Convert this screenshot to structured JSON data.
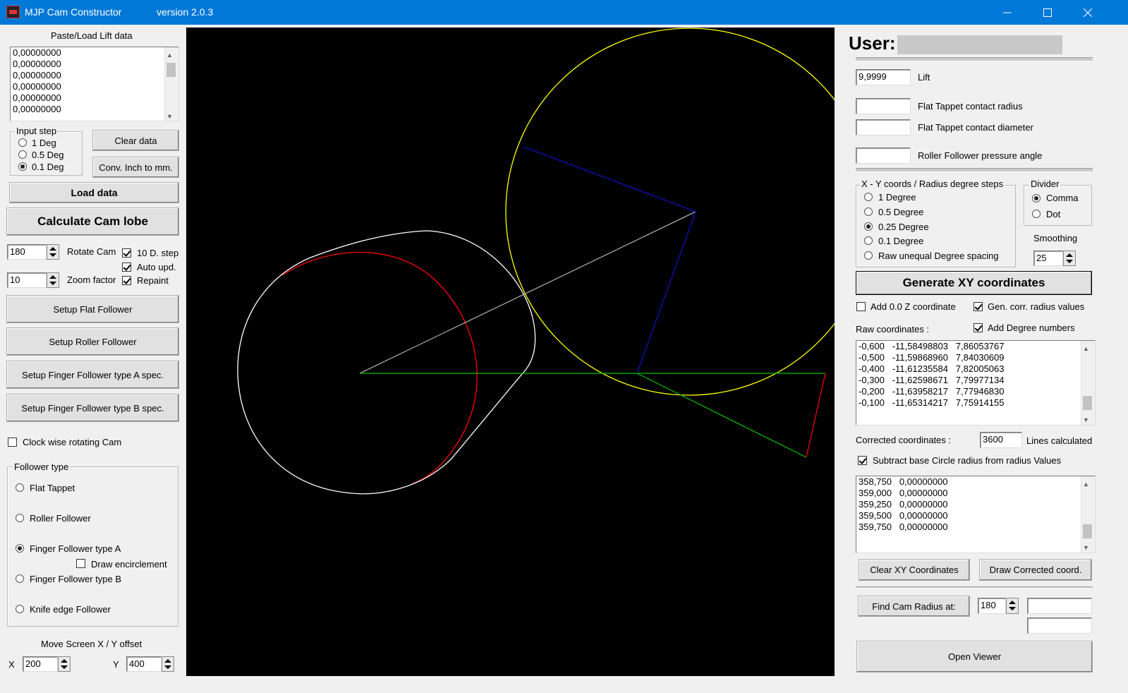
{
  "titlebar": {
    "app_name": "MJP Cam Constructor",
    "version": "version 2.0.3"
  },
  "left": {
    "paste_label": "Paste/Load Lift data",
    "lift_lines": [
      "0,00000000",
      "0,00000000",
      "0,00000000",
      "0,00000000",
      "0,00000000",
      "0,00000000"
    ],
    "input_step": {
      "title": "Input step",
      "options": [
        "1 Deg",
        "0.5 Deg",
        "0.1 Deg"
      ],
      "selected": 2
    },
    "clear_data": "Clear data",
    "conv_inch": "Conv. Inch to mm.",
    "load_data": "Load data",
    "calculate": "Calculate Cam lobe",
    "rotate_value": "180",
    "rotate_label": "Rotate Cam",
    "zoom_value": "10",
    "zoom_label": "Zoom factor",
    "chk_10d": "10 D. step",
    "chk_auto": "Auto upd.",
    "chk_repaint": "Repaint",
    "setup_flat": "Setup Flat Follower",
    "setup_roller": "Setup Roller Follower",
    "setup_finger_a": "Setup Finger Follower type A spec.",
    "setup_finger_b": "Setup Finger Follower type B spec.",
    "clockwise": "Clock wise rotating Cam",
    "follower_type": {
      "title": "Follower type",
      "flat": "Flat Tappet",
      "roller": "Roller Follower",
      "finger_a": "Finger Follower type A",
      "draw_encirclement": "Draw encirclement",
      "finger_b": "Finger Follower type B",
      "knife": "Knife edge Follower"
    },
    "move_offset": "Move Screen X / Y offset",
    "x_label": "X",
    "x_value": "200",
    "y_label": "Y",
    "y_value": "400"
  },
  "right": {
    "user_label": "User:",
    "lift_value": "9,9999",
    "lift_label": "Lift",
    "flat_radius_label": "Flat Tappet contact radius",
    "flat_diameter_label": "Flat Tappet contact diameter",
    "roller_angle_label": "Roller Follower pressure angle",
    "xy_group": {
      "title": "X - Y coords / Radius degree steps",
      "options": [
        "1 Degree",
        "0.5 Degree",
        "0.25 Degree",
        "0.1 Degree",
        "Raw unequal Degree spacing"
      ],
      "selected": 2
    },
    "divider": {
      "title": "Divider",
      "comma": "Comma",
      "dot": "Dot"
    },
    "smoothing_label": "Smoothing",
    "smoothing_value": "25",
    "generate": "Generate XY coordinates",
    "add_00z": "Add 0.0 Z coordinate",
    "gen_corr": "Gen. corr. radius values",
    "raw_label": "Raw coordinates :",
    "add_degree": "Add Degree numbers",
    "raw_lines": [
      "-0,600   -11,58498803   7,86053767",
      "-0,500   -11,59868960   7,84030609",
      "-0,400   -11,61235584   7,82005063",
      "-0,300   -11,62598671   7,79977134",
      "-0,200   -11,63958217   7,77946830",
      "-0,100   -11,65314217   7,75914155"
    ],
    "corrected_label": "Corrected coordinates :",
    "lines_value": "3600",
    "lines_label": "Lines calculated",
    "subtract": "Subtract base Circle radius  from radius Values",
    "corr_lines": [
      "358,750   0,00000000",
      "359,000   0,00000000",
      "359,250   0,00000000",
      "359,500   0,00000000",
      "359,750   0,00000000"
    ],
    "clear_xy": "Clear XY Coordinates",
    "draw_corrected": "Draw Corrected coord.",
    "find_radius": "Find Cam Radius at:",
    "find_value": "180",
    "open_viewer": "Open Viewer"
  }
}
